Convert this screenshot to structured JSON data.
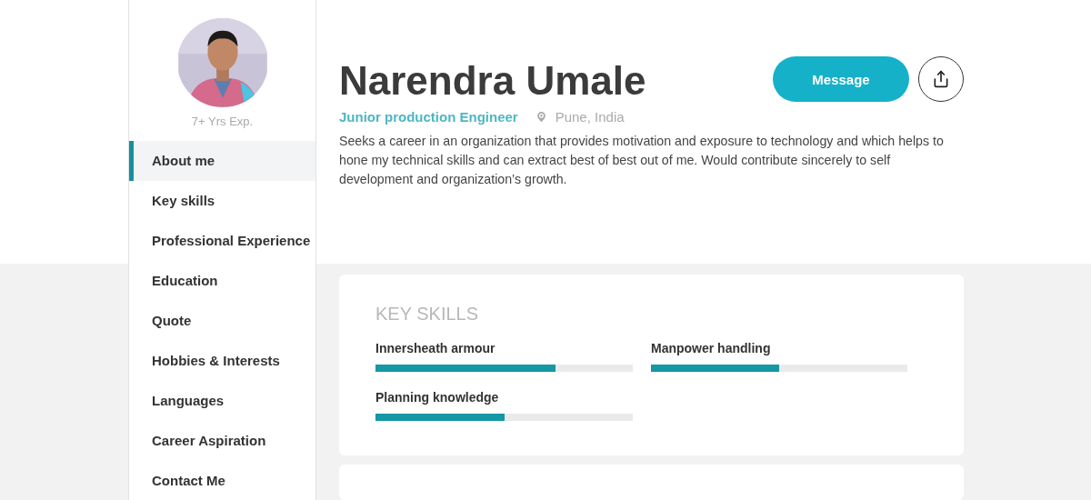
{
  "profile": {
    "experience": "7+ Yrs Exp.",
    "name": "Narendra Umale",
    "job_title": "Junior production Engineer",
    "location": "Pune, India",
    "summary": "Seeks a career in an organization that provides motivation and exposure to technology and which helps to hone my technical skills and can extract best of best out of me. Would contribute sincerely to self development and organization’s growth."
  },
  "actions": {
    "message_button": "Message"
  },
  "sidebar": {
    "items": [
      {
        "label": "About me",
        "selected": true
      },
      {
        "label": "Key skills",
        "selected": false
      },
      {
        "label": "Professional Experience",
        "selected": false
      },
      {
        "label": "Education",
        "selected": false
      },
      {
        "label": "Quote",
        "selected": false
      },
      {
        "label": "Hobbies & Interests",
        "selected": false
      },
      {
        "label": "Languages",
        "selected": false
      },
      {
        "label": "Career Aspiration",
        "selected": false
      },
      {
        "label": "Contact Me",
        "selected": false
      }
    ]
  },
  "key_skills": {
    "title": "KEY SKILLS",
    "skills": [
      {
        "name": "Innersheath armour",
        "level": 0.7
      },
      {
        "name": "Manpower handling",
        "level": 0.5
      },
      {
        "name": "Planning knowledge",
        "level": 0.5
      }
    ]
  }
}
